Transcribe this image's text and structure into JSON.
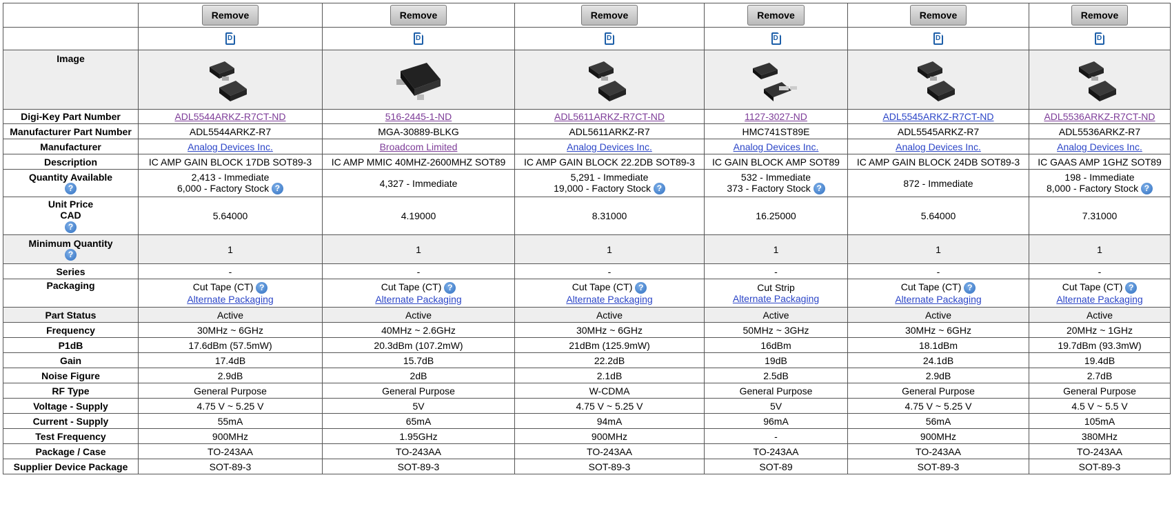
{
  "buttons": {
    "remove": "Remove"
  },
  "row_labels": {
    "image": "Image",
    "digikey_pn": "Digi-Key Part Number",
    "mfr_pn": "Manufacturer Part Number",
    "manufacturer": "Manufacturer",
    "description": "Description",
    "quantity_available": "Quantity Available",
    "unit_price_1": "Unit Price",
    "unit_price_2": "CAD",
    "minimum_quantity": "Minimum Quantity",
    "series": "Series",
    "packaging": "Packaging",
    "part_status": "Part Status",
    "frequency": "Frequency",
    "p1db": "P1dB",
    "gain": "Gain",
    "noise_figure": "Noise Figure",
    "rf_type": "RF Type",
    "voltage_supply": "Voltage - Supply",
    "current_supply": "Current - Supply",
    "test_frequency": "Test Frequency",
    "package_case": "Package / Case",
    "supplier_device_package": "Supplier Device Package"
  },
  "help_glyph": "?",
  "icons": {
    "datasheet": "datasheet-pdf-icon",
    "help": "help-question-icon",
    "part_image": "sot89-part-image"
  },
  "colors": {
    "link": "#2b45c7",
    "visited_link": "#7d3c98",
    "help_icon": "#2f6fc0",
    "shaded_row": "#eeeeee"
  },
  "products": [
    {
      "digikey_pn": "ADL5544ARKZ-R7CT-ND",
      "digikey_visited": true,
      "mfr_pn": "ADL5544ARKZ-R7",
      "manufacturer": "Analog Devices Inc.",
      "manufacturer_visited": false,
      "description": "IC AMP GAIN BLOCK 17DB SOT89-3",
      "qty_line1": "2,413 - Immediate",
      "qty_line2": "6,000 - Factory Stock",
      "unit_price": "5.64000",
      "min_qty": "1",
      "series": "-",
      "packaging": "Cut Tape (CT)",
      "packaging_help": true,
      "alt_packaging": "Alternate Packaging",
      "part_status": "Active",
      "frequency": "30MHz ~ 6GHz",
      "p1db": "17.6dBm (57.5mW)",
      "gain": "17.4dB",
      "noise_figure": "2.9dB",
      "rf_type": "General Purpose",
      "voltage_supply": "4.75 V ~ 5.25 V",
      "current_supply": "55mA",
      "test_frequency": "900MHz",
      "package_case": "TO-243AA",
      "supplier_device_package": "SOT-89-3",
      "image_style": "sot89"
    },
    {
      "digikey_pn": "516-2445-1-ND",
      "digikey_visited": true,
      "mfr_pn": "MGA-30889-BLKG",
      "manufacturer": "Broadcom Limited",
      "manufacturer_visited": true,
      "description": "IC AMP MMIC 40MHZ-2600MHZ SOT89",
      "qty_line1": "4,327 - Immediate",
      "qty_line2": "",
      "unit_price": "4.19000",
      "min_qty": "1",
      "series": "-",
      "packaging": "Cut Tape (CT)",
      "packaging_help": true,
      "alt_packaging": "Alternate Packaging",
      "part_status": "Active",
      "frequency": "40MHz ~ 2.6GHz",
      "p1db": "20.3dBm (107.2mW)",
      "gain": "15.7dB",
      "noise_figure": "2dB",
      "rf_type": "General Purpose",
      "voltage_supply": "5V",
      "current_supply": "65mA",
      "test_frequency": "1.95GHz",
      "package_case": "TO-243AA",
      "supplier_device_package": "SOT-89-3",
      "image_style": "sot89-large"
    },
    {
      "digikey_pn": "ADL5611ARKZ-R7CT-ND",
      "digikey_visited": true,
      "mfr_pn": "ADL5611ARKZ-R7",
      "manufacturer": "Analog Devices Inc.",
      "manufacturer_visited": false,
      "description": "IC AMP GAIN BLOCK 22.2DB SOT89-3",
      "qty_line1": "5,291 - Immediate",
      "qty_line2": "19,000 - Factory Stock",
      "unit_price": "8.31000",
      "min_qty": "1",
      "series": "-",
      "packaging": "Cut Tape (CT)",
      "packaging_help": true,
      "alt_packaging": "Alternate Packaging",
      "part_status": "Active",
      "frequency": "30MHz ~ 6GHz",
      "p1db": "21dBm (125.9mW)",
      "gain": "22.2dB",
      "noise_figure": "2.1dB",
      "rf_type": "W-CDMA",
      "voltage_supply": "4.75 V ~ 5.25 V",
      "current_supply": "94mA",
      "test_frequency": "900MHz",
      "package_case": "TO-243AA",
      "supplier_device_package": "SOT-89-3",
      "image_style": "sot89"
    },
    {
      "digikey_pn": "1127-3027-ND",
      "digikey_visited": true,
      "mfr_pn": "HMC741ST89E",
      "manufacturer": "Analog Devices Inc.",
      "manufacturer_visited": false,
      "description": "IC GAIN BLOCK AMP SOT89",
      "qty_line1": "532 - Immediate",
      "qty_line2": "373 - Factory Stock",
      "unit_price": "16.25000",
      "min_qty": "1",
      "series": "-",
      "packaging": "Cut Strip",
      "packaging_help": false,
      "alt_packaging": "Alternate Packaging",
      "part_status": "Active",
      "frequency": "50MHz ~ 3GHz",
      "p1db": "16dBm",
      "gain": "19dB",
      "noise_figure": "2.5dB",
      "rf_type": "General Purpose",
      "voltage_supply": "5V",
      "current_supply": "96mA",
      "test_frequency": "-",
      "package_case": "TO-243AA",
      "supplier_device_package": "SOT-89",
      "image_style": "sot89-tab"
    },
    {
      "digikey_pn": "ADL5545ARKZ-R7CT-ND",
      "digikey_visited": false,
      "mfr_pn": "ADL5545ARKZ-R7",
      "manufacturer": "Analog Devices Inc.",
      "manufacturer_visited": false,
      "description": "IC AMP GAIN BLOCK 24DB SOT89-3",
      "qty_line1": "872 - Immediate",
      "qty_line2": "",
      "unit_price": "5.64000",
      "min_qty": "1",
      "series": "-",
      "packaging": "Cut Tape (CT)",
      "packaging_help": true,
      "alt_packaging": "Alternate Packaging",
      "part_status": "Active",
      "frequency": "30MHz ~ 6GHz",
      "p1db": "18.1dBm",
      "gain": "24.1dB",
      "noise_figure": "2.9dB",
      "rf_type": "General Purpose",
      "voltage_supply": "4.75 V ~ 5.25 V",
      "current_supply": "56mA",
      "test_frequency": "900MHz",
      "package_case": "TO-243AA",
      "supplier_device_package": "SOT-89-3",
      "image_style": "sot89"
    },
    {
      "digikey_pn": "ADL5536ARKZ-R7CT-ND",
      "digikey_visited": true,
      "mfr_pn": "ADL5536ARKZ-R7",
      "manufacturer": "Analog Devices Inc.",
      "manufacturer_visited": false,
      "description": "IC GAAS AMP 1GHZ SOT89",
      "qty_line1": "198 - Immediate",
      "qty_line2": "8,000 - Factory Stock",
      "unit_price": "7.31000",
      "min_qty": "1",
      "series": "-",
      "packaging": "Cut Tape (CT)",
      "packaging_help": true,
      "alt_packaging": "Alternate Packaging",
      "part_status": "Active",
      "frequency": "20MHz ~ 1GHz",
      "p1db": "19.7dBm (93.3mW)",
      "gain": "19.4dB",
      "noise_figure": "2.7dB",
      "rf_type": "General Purpose",
      "voltage_supply": "4.5 V ~ 5.5 V",
      "current_supply": "105mA",
      "test_frequency": "380MHz",
      "package_case": "TO-243AA",
      "supplier_device_package": "SOT-89-3",
      "image_style": "sot89"
    }
  ]
}
